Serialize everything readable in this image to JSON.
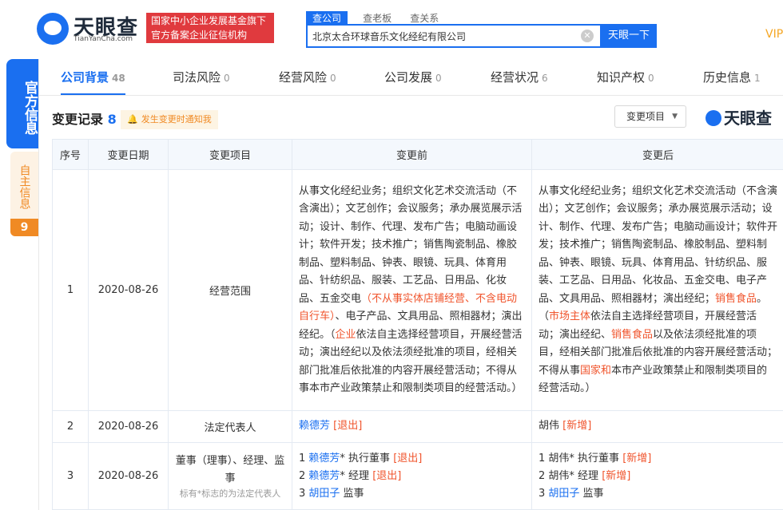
{
  "header": {
    "logo_name": "天眼查",
    "logo_site": "TianYanCha.com",
    "badge_line1": "国家中小企业发展基金旗下",
    "badge_line2": "官方备案企业征信机构",
    "search_tabs": [
      "查公司",
      "查老板",
      "查关系"
    ],
    "search_value": "北京太合环球音乐文化经纪有限公司",
    "search_button": "天眼一下",
    "vip": "VIP"
  },
  "side": {
    "official": "官方信息",
    "self": "自主信息",
    "self_count": "9"
  },
  "tabs": [
    {
      "label": "公司背景",
      "count": "48"
    },
    {
      "label": "司法风险",
      "count": "0"
    },
    {
      "label": "经营风险",
      "count": "0"
    },
    {
      "label": "公司发展",
      "count": "0"
    },
    {
      "label": "经营状况",
      "count": "6"
    },
    {
      "label": "知识产权",
      "count": "0"
    },
    {
      "label": "历史信息",
      "count": "1"
    }
  ],
  "section": {
    "title": "变更记录",
    "count": "8",
    "notify": "发生变更时通知我",
    "filter": "变更项目",
    "watermark": "天眼查"
  },
  "table": {
    "headers": [
      "序号",
      "变更日期",
      "变更项目",
      "变更前",
      "变更后"
    ],
    "rows": [
      {
        "no": "1",
        "date": "2020-08-26",
        "item": "经营范围",
        "before": [
          {
            "t": "从事文化经纪业务；组织文化艺术交流活动（不含演出）；文艺创作；会议服务；承办展览展示活动；设计、制作、代理、发布广告；电脑动画设计；软件开发；技术推广；销售陶瓷制品、橡胶制品、塑料制品、钟表、眼镜、玩具、体育用品、针纺织品、服装、工艺品、日用品、化妆品、五金交电"
          },
          {
            "t": "（不从事实体店铺经营、不含电动自行车）",
            "h": true
          },
          {
            "t": "、电子产品、文具用品、照相器材；演出经纪。（"
          },
          {
            "t": "企业",
            "h": true
          },
          {
            "t": "依法自主选择经营项目，开展经营活动；演出经纪以及依法须经批准的项目，经相关部门批准后依批准的内容开展经营活动；不得从事本市产业政策禁止和限制类项目的经营活动。）"
          }
        ],
        "after": [
          {
            "t": "从事文化经纪业务；组织文化艺术交流活动（不含演出）；文艺创作；会议服务；承办展览展示活动；设计、制作、代理、发布广告；电脑动画设计；软件开发；技术推广；销售陶瓷制品、橡胶制品、塑料制品、钟表、眼镜、玩具、体育用品、针纺织品、服装、工艺品、日用品、化妆品、五金交电、电子产品、文具用品、照相器材；演出经纪；"
          },
          {
            "t": "销售食品",
            "h": true
          },
          {
            "t": "。（"
          },
          {
            "t": "市场主体",
            "h": true
          },
          {
            "t": "依法自主选择经营项目，开展经营活动；演出经纪、"
          },
          {
            "t": "销售食品",
            "h": true
          },
          {
            "t": "以及依法须经批准的项目，经相关部门批准后依批准的内容开展经营活动；不得从事"
          },
          {
            "t": "国家和",
            "h": true
          },
          {
            "t": "本市产业政策禁止和限制类项目的经营活动。）"
          }
        ]
      },
      {
        "no": "2",
        "date": "2020-08-26",
        "item": "法定代表人",
        "before_name": "赖德芳",
        "before_tag": "[退出]",
        "after_name": "胡伟",
        "after_tag": "[新增]"
      },
      {
        "no": "3",
        "date": "2020-08-26",
        "item": "董事（理事）、经理、监事",
        "item_note": "标有*标志的为法定代表人",
        "before_lines": [
          {
            "prefix": "1 ",
            "name": "赖德芳",
            "rest": "* 执行董事 ",
            "tag": "[退出]"
          },
          {
            "prefix": "2 ",
            "name": "赖德芳",
            "rest": "* 经理 ",
            "tag": "[退出]"
          },
          {
            "prefix": "3 ",
            "name": "胡田子",
            "rest": " 监事",
            "tag": ""
          }
        ],
        "after_lines": [
          {
            "prefix": "1 ",
            "name": "胡伟",
            "rest": "* 执行董事 ",
            "tag": "[新增]"
          },
          {
            "prefix": "2 ",
            "name": "胡伟",
            "rest": "* 经理 ",
            "tag": "[新增]"
          },
          {
            "prefix": "3 ",
            "name": "胡田子",
            "rest": " 监事",
            "tag": ""
          }
        ]
      }
    ]
  }
}
